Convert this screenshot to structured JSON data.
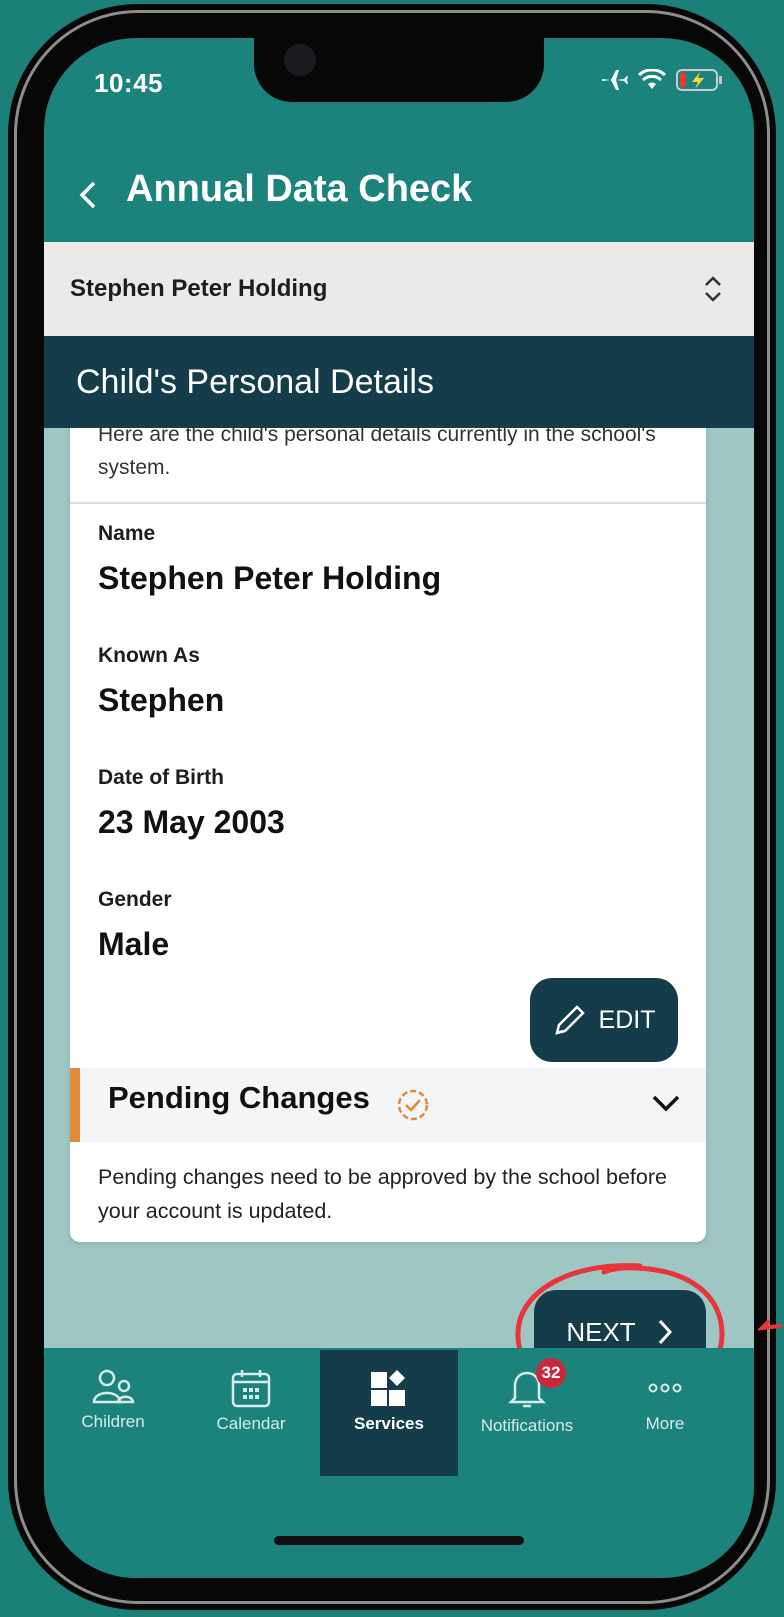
{
  "status_bar": {
    "time": "10:45",
    "icons": [
      "airplane-icon",
      "wifi-icon",
      "battery-charging-icon"
    ]
  },
  "header": {
    "back_icon": "chevron-left-icon",
    "title": "Annual Data Check"
  },
  "child_selector": {
    "selected": "Stephen Peter Holding",
    "icon": "chevron-up-down-icon"
  },
  "section": {
    "title": "Child's Personal Details"
  },
  "card": {
    "intro": "Here are the child's personal details currently in the school's system.",
    "fields": [
      {
        "label": "Name",
        "value": "Stephen Peter Holding"
      },
      {
        "label": "Known As",
        "value": "Stephen"
      },
      {
        "label": "Date of Birth",
        "value": "23 May 2003"
      },
      {
        "label": "Gender",
        "value": "Male"
      }
    ],
    "edit_label": "EDIT"
  },
  "pending": {
    "title": "Pending Changes",
    "note": "Pending changes need to be approved by the school before your account is updated."
  },
  "next_label": "NEXT",
  "nav": {
    "items": [
      {
        "label": "Children",
        "icon": "children-icon"
      },
      {
        "label": "Calendar",
        "icon": "calendar-icon"
      },
      {
        "label": "Services",
        "icon": "services-icon"
      },
      {
        "label": "Notifications",
        "icon": "bell-icon",
        "badge": "32"
      },
      {
        "label": "More",
        "icon": "more-icon"
      }
    ],
    "active": "Services"
  },
  "colors": {
    "primary": "#1b837b",
    "dark": "#153c4a",
    "accent": "#e38a3a",
    "badge": "#c9283c",
    "annotation": "#e8343a"
  }
}
